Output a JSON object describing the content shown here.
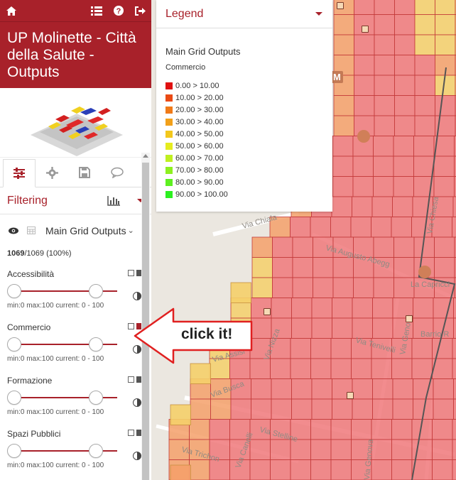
{
  "app": {
    "title": "UP Molinette - Città della Salute - Outputs",
    "title_lines": [
      "UP Molinette - Città",
      "della Salute -",
      "Outputs"
    ]
  },
  "topbar": {
    "icons": [
      "home-icon",
      "list-icon",
      "help-icon",
      "sign-out-icon"
    ]
  },
  "tabs": [
    {
      "icon": "sliders-icon",
      "active": true
    },
    {
      "icon": "gear-icon",
      "active": false
    },
    {
      "icon": "save-icon",
      "active": false
    },
    {
      "icon": "comment-icon",
      "active": false
    }
  ],
  "filtering": {
    "label": "Filtering",
    "layer": "Main Grid Outputs",
    "count_bold": "1069",
    "count_rest": "/1069 (100%)"
  },
  "filters": [
    {
      "name": "Accessibilità",
      "range": "min:0 max:100 current: 0 - 100",
      "min": 0,
      "max": 100,
      "low": 0,
      "high": 100,
      "active_color": false
    },
    {
      "name": "Commercio",
      "range": "min:0 max:100 current: 0 - 100",
      "min": 0,
      "max": 100,
      "low": 0,
      "high": 100,
      "active_color": true
    },
    {
      "name": "Formazione",
      "range": "min:0 max:100 current: 0 - 100",
      "min": 0,
      "max": 100,
      "low": 0,
      "high": 100,
      "active_color": false
    },
    {
      "name": "Spazi Pubblici",
      "range": "min:0 max:100 current: 0 - 100",
      "min": 0,
      "max": 100,
      "low": 0,
      "high": 100,
      "active_color": false
    }
  ],
  "legend": {
    "title": "Legend",
    "layer": "Main Grid Outputs",
    "field": "Commercio",
    "classes": [
      {
        "label": "0.00 > 10.00",
        "color": "#e01010"
      },
      {
        "label": "10.00 > 20.00",
        "color": "#ea4a14"
      },
      {
        "label": "20.00 > 30.00",
        "color": "#f07a18"
      },
      {
        "label": "30.00 > 40.00",
        "color": "#f2a01a"
      },
      {
        "label": "40.00 > 50.00",
        "color": "#f3c81c"
      },
      {
        "label": "50.00 > 60.00",
        "color": "#e5ec1e"
      },
      {
        "label": "60.00 > 70.00",
        "color": "#bff020"
      },
      {
        "label": "70.00 > 80.00",
        "color": "#8ef020"
      },
      {
        "label": "80.00 > 90.00",
        "color": "#5ef020"
      },
      {
        "label": "90.00 > 100.00",
        "color": "#2cf020"
      }
    ]
  },
  "callout": {
    "text": "click it!"
  },
  "map": {
    "streets": [
      "Via Chiala",
      "Via Augusto Abegg",
      "La Capricci",
      "Via Tenivelli",
      "Via Nizza",
      "Via Genova",
      "Barrio R",
      "Via Assisi",
      "Via Busca",
      "Via Stelline",
      "Via Trichon",
      "Via Genova",
      "Via Chiesa",
      "Via Canelli"
    ],
    "metro_label": "M"
  },
  "colors": {
    "brand": "#a8212a",
    "cell_red": "#f0787a",
    "cell_orange": "#f5a06a",
    "cell_yellow": "#f5cf6a"
  }
}
